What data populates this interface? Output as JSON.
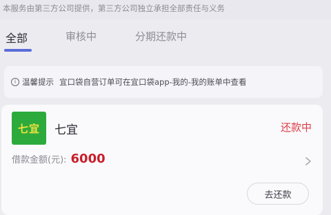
{
  "top_notice": "本服务由第三方公司提供，第三方公司独立承担全部责任与义务",
  "tabs": [
    {
      "label": "全部",
      "active": true
    },
    {
      "label": "审核中",
      "active": false
    },
    {
      "label": "分期还款中",
      "active": false
    }
  ],
  "tip": {
    "icon": "info-icon",
    "label": "温馨提示",
    "text": "宜口袋自营订单可在宜口袋app-我的-我的账单中查看"
  },
  "order": {
    "logo_text": "七宜",
    "merchant_name": "七宜",
    "status": "还款中",
    "amount_label": "借款金额(元):",
    "amount_value": "6000",
    "action_label": "去还款"
  },
  "colors": {
    "tab_indicator": "#5b6bd8",
    "status_red": "#de3c46",
    "amount_red": "#c81e2b",
    "logo_green": "#2cab3c",
    "logo_yellow": "#f2e23c"
  }
}
